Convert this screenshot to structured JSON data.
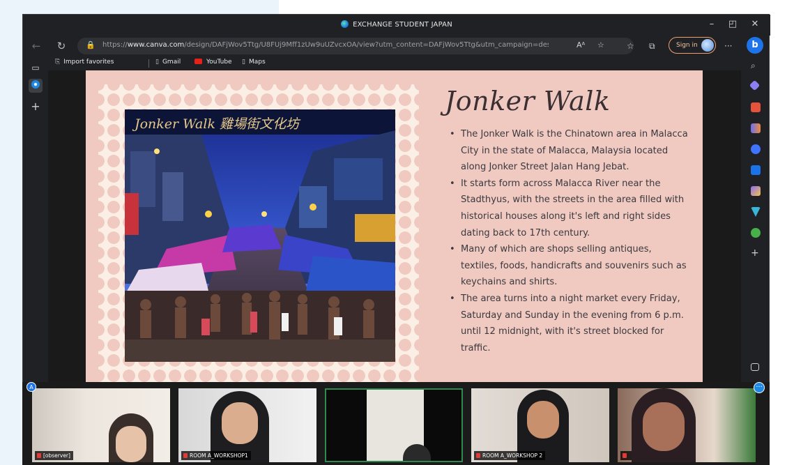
{
  "browser": {
    "window_title": "EXCHANGE STUDENT JAPAN",
    "url_prefix": "https://",
    "url_domain": "www.canva.com",
    "url_rest": "/design/DAFjWov5Ttg/U8FUj9Mff1zUw9uUZvcxOA/view?utm_content=DAFjWov5Ttg&utm_campaign=designshar...",
    "sign_in_label": "Sign in",
    "more_label": "···",
    "bing_label": "b"
  },
  "favorites": [
    {
      "label": "Import favorites",
      "icon": "import-icon"
    },
    {
      "label": "Gmail",
      "icon": "page-icon"
    },
    {
      "label": "YouTube",
      "icon": "youtube-icon"
    },
    {
      "label": "Maps",
      "icon": "page-icon"
    }
  ],
  "slide": {
    "heading": "Jonker Walk",
    "bullets": [
      "The Jonker Walk is the Chinatown area in Malacca City in the state of Malacca, Malaysia located along Jonker Street Jalan Hang Jebat.",
      "It starts form across Malacca River near the Stadthyus, with the streets in the area filled with historical houses along it's left and right sides dating back to 17th century.",
      "Many of which are shops selling antiques, textiles, foods, handicrafts and souvenirs such as keychains and shirts.",
      "The area turns into a night market every Friday, Saturday and Sunday in the evening from 6 p.m. until 12 midnight, with it's street blocked for traffic."
    ],
    "photo_sign": "Jonker Walk 雞場街文化坊"
  },
  "participants": [
    {
      "name": "[observer]"
    },
    {
      "name": "ROOM A_WORKSHOP1"
    },
    {
      "name": ""
    },
    {
      "name": "ROOM A_WORKSHOP 2"
    },
    {
      "name": ""
    }
  ],
  "badges": {
    "user_badge": "A",
    "more_badge": "···"
  },
  "colors": {
    "slide_bg": "#f0c9c0",
    "stamp": "#fbeee4",
    "browser_bg": "#202124",
    "signin_border": "#f0a070"
  }
}
